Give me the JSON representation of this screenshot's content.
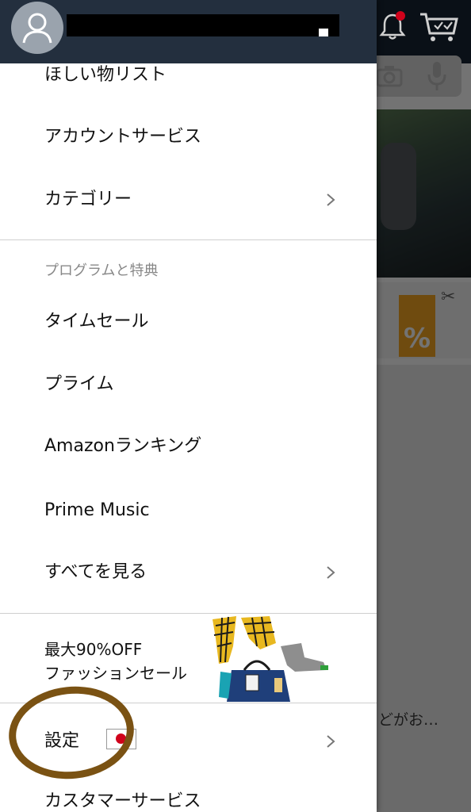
{
  "header": {
    "avatar_icon": "user-avatar-icon",
    "username_redacted": true
  },
  "menu": {
    "wishlist": "ほしい物リスト",
    "account_services": "アカウントサービス",
    "categories": "カテゴリー"
  },
  "programs_section": {
    "title": "プログラムと特典",
    "items": [
      "タイムセール",
      "プライム",
      "Amazonランキング",
      "Prime Music",
      "すべてを見る"
    ]
  },
  "promo": {
    "line1": "最大90%OFF",
    "line2": "ファッションセール",
    "image": "fashion-items-image"
  },
  "settings": {
    "label": "設定",
    "flag": "japan-flag-icon"
  },
  "customer_service": "カスタマーサービス",
  "background": {
    "snippet": "どがお…",
    "coupon_symbol": "%"
  },
  "colors": {
    "header": "#232f3e",
    "annotation_circle": "#7a5213",
    "promo_orange": "#f6a623"
  }
}
